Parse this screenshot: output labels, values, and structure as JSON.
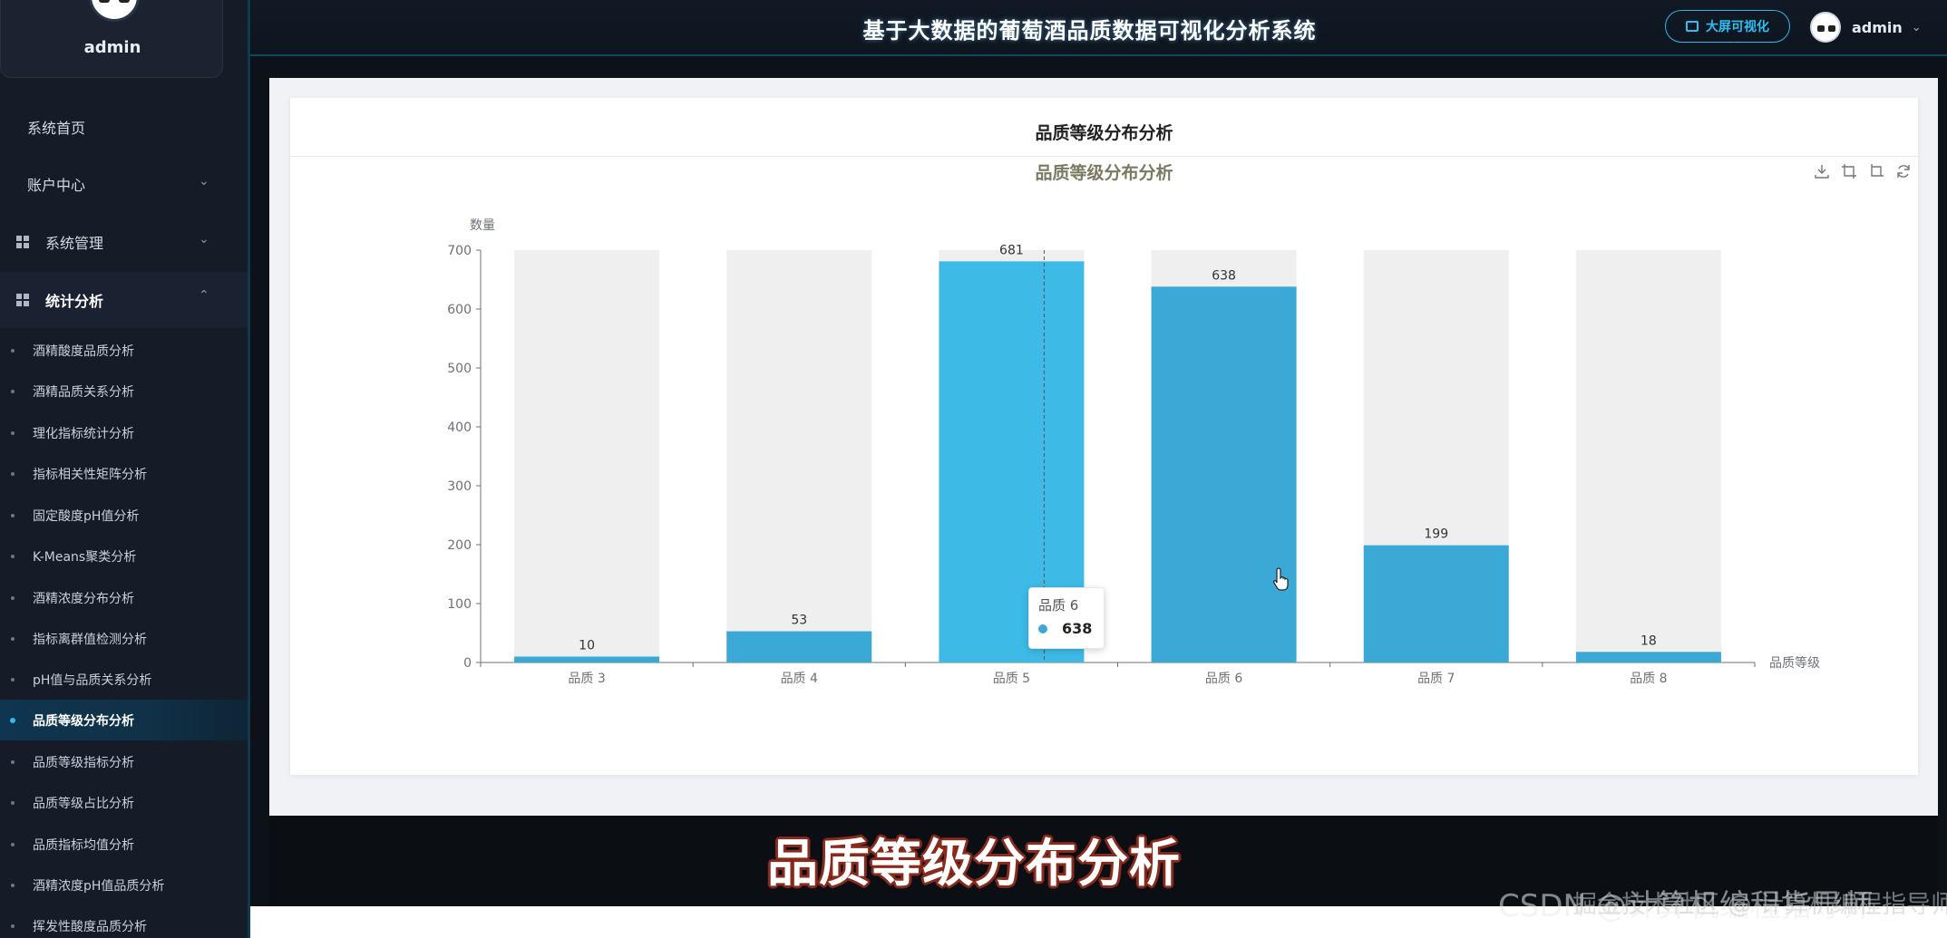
{
  "profile": {
    "name": "admin"
  },
  "header": {
    "title": "基于大数据的葡萄酒品质数据可视化分析系统",
    "bigscreen_label": "大屏可视化",
    "user_name": "admin"
  },
  "sidebar": {
    "menu": [
      {
        "label": "系统首页"
      },
      {
        "label": "账户中心"
      },
      {
        "label": "系统管理"
      },
      {
        "label": "统计分析"
      }
    ],
    "sub_items": [
      {
        "label": "酒精酸度品质分析"
      },
      {
        "label": "酒精品质关系分析"
      },
      {
        "label": "理化指标统计分析"
      },
      {
        "label": "指标相关性矩阵分析"
      },
      {
        "label": "固定酸度pH值分析"
      },
      {
        "label": "K-Means聚类分析"
      },
      {
        "label": "酒精浓度分布分析"
      },
      {
        "label": "指标离群值检测分析"
      },
      {
        "label": "pH值与品质关系分析"
      },
      {
        "label": "品质等级分布分析",
        "active": true
      },
      {
        "label": "品质等级指标分析"
      },
      {
        "label": "品质等级占比分析"
      },
      {
        "label": "品质指标均值分析"
      },
      {
        "label": "酒精浓度pH值品质分析"
      },
      {
        "label": "挥发性酸度品质分析"
      }
    ]
  },
  "card": {
    "title": "品质等级分布分析"
  },
  "chart_data": {
    "type": "bar",
    "title": "品质等级分布分析",
    "xlabel": "品质等级",
    "ylabel": "数量",
    "categories": [
      "品质 3",
      "品质 4",
      "品质 5",
      "品质 6",
      "品质 7",
      "品质 8"
    ],
    "values": [
      10,
      53,
      681,
      638,
      199,
      18
    ],
    "ylim": [
      0,
      700
    ],
    "yticks": [
      0,
      100,
      200,
      300,
      400,
      500,
      600,
      700
    ],
    "background_bars": true,
    "colors": {
      "bar": "#3aa9d6",
      "bar_highlight": "#3dbbe6",
      "background": "#efefef"
    }
  },
  "tooltip": {
    "title": "品质 6",
    "value": "638"
  },
  "caption": "品质等级分布分析",
  "watermark": "CSDN @计算机编程指导师",
  "watermark2": "掘金技术社区 @ 计算机编程指导师"
}
